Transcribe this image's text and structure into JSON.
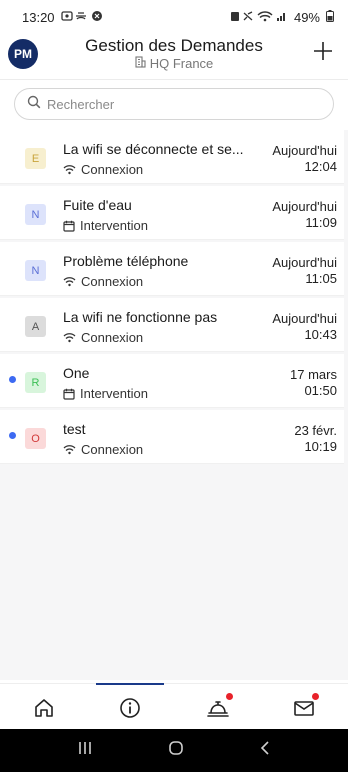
{
  "status_bar": {
    "time": "13:20",
    "battery": "49%"
  },
  "header": {
    "avatar_initials": "PM",
    "title": "Gestion des Demandes",
    "location": "HQ France"
  },
  "search": {
    "placeholder": "Rechercher"
  },
  "requests": [
    {
      "title": "La wifi se déconnecte et se...",
      "category": "Connexion",
      "category_icon": "wifi-icon",
      "badge": "E",
      "badge_color": "#f7efcf",
      "badge_text_color": "#c9a43c",
      "date": "Aujourd'hui",
      "time": "12:04",
      "unread": false
    },
    {
      "title": "Fuite d'eau",
      "category": "Intervention",
      "category_icon": "calendar-icon",
      "badge": "N",
      "badge_color": "#dde3fb",
      "badge_text_color": "#5b6fd6",
      "date": "Aujourd'hui",
      "time": "11:09",
      "unread": false
    },
    {
      "title": "Problème téléphone",
      "category": "Connexion",
      "category_icon": "wifi-icon",
      "badge": "N",
      "badge_color": "#dde3fb",
      "badge_text_color": "#5b6fd6",
      "date": "Aujourd'hui",
      "time": "11:05",
      "unread": false
    },
    {
      "title": "La wifi ne fonctionne pas",
      "category": "Connexion",
      "category_icon": "wifi-icon",
      "badge": "A",
      "badge_color": "#dcdcdc",
      "badge_text_color": "#555555",
      "date": "Aujourd'hui",
      "time": "10:43",
      "unread": false
    },
    {
      "title": "One",
      "category": "Intervention",
      "category_icon": "calendar-icon",
      "badge": "R",
      "badge_color": "#d8f5dc",
      "badge_text_color": "#3bbf55",
      "date": "17 mars",
      "time": "01:50",
      "unread": true
    },
    {
      "title": "test",
      "category": "Connexion",
      "category_icon": "wifi-icon",
      "badge": "O",
      "badge_color": "#fbd9d9",
      "badge_text_color": "#d23b3b",
      "date": "23 févr.",
      "time": "10:19",
      "unread": true
    }
  ],
  "bottom_nav": [
    {
      "icon": "home-icon",
      "active": false,
      "notification": false
    },
    {
      "icon": "info-icon",
      "active": true,
      "notification": false
    },
    {
      "icon": "service-bell-icon",
      "active": false,
      "notification": true
    },
    {
      "icon": "mail-icon",
      "active": false,
      "notification": true
    }
  ],
  "colors": {
    "accent": "#142c66",
    "unread": "#3d6af2",
    "notification": "#e8222a"
  }
}
